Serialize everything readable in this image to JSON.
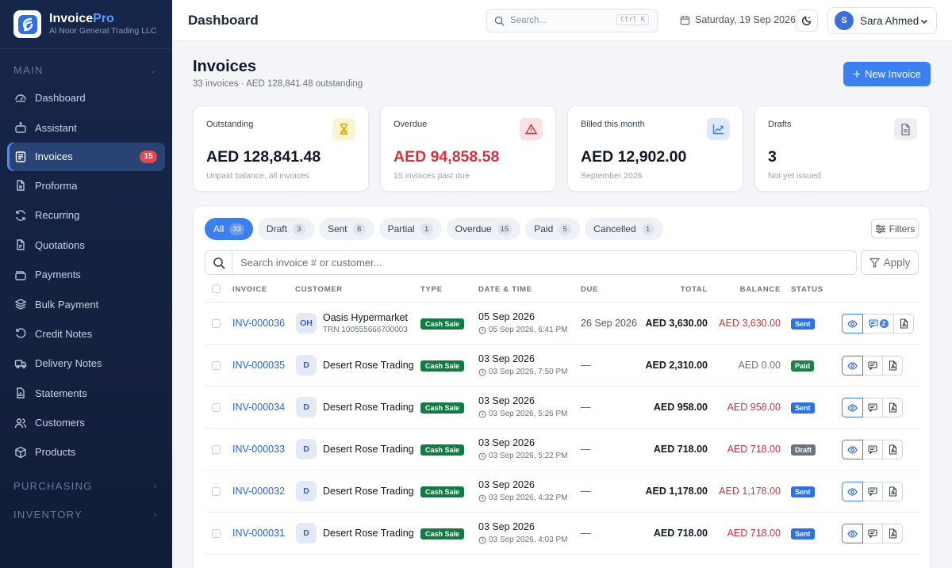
{
  "brand": {
    "name_main": "Invoice",
    "name_accent": "Pro",
    "company": "Al Noor General Trading LLC"
  },
  "sidebar": {
    "section_main": "MAIN",
    "items": [
      {
        "label": "Dashboard",
        "icon": "dashboard-icon"
      },
      {
        "label": "Assistant",
        "icon": "robot-icon"
      },
      {
        "label": "Invoices",
        "icon": "invoice-icon",
        "badge": "15",
        "active": true
      },
      {
        "label": "Proforma",
        "icon": "document-icon"
      },
      {
        "label": "Recurring",
        "icon": "refresh-icon"
      },
      {
        "label": "Quotations",
        "icon": "quote-document-icon"
      },
      {
        "label": "Payments",
        "icon": "wallet-icon"
      },
      {
        "label": "Bulk Payment",
        "icon": "layers-icon"
      },
      {
        "label": "Credit Notes",
        "icon": "undo-icon"
      },
      {
        "label": "Delivery Notes",
        "icon": "truck-icon"
      },
      {
        "label": "Statements",
        "icon": "statement-icon"
      },
      {
        "label": "Customers",
        "icon": "users-icon"
      },
      {
        "label": "Products",
        "icon": "box-icon"
      }
    ],
    "section_purchasing": "PURCHASING",
    "section_inventory": "INVENTORY"
  },
  "topbar": {
    "title": "Dashboard",
    "search_placeholder": "Search...",
    "search_shortcut": "Ctrl K",
    "date": "Saturday, 19 Sep 2026",
    "user_initial": "S",
    "user_name": "Sara Ahmed"
  },
  "page": {
    "title": "Invoices",
    "subtitle": "33 invoices · AED 128,841.48 outstanding",
    "new_button": "New Invoice"
  },
  "cards": [
    {
      "label": "Outstanding",
      "value": "AED 128,841.48",
      "sub": "Unpaid balance, all invoices",
      "icon": "hourglass-icon",
      "color": "#f5b400"
    },
    {
      "label": "Overdue",
      "value": "AED 94,858.58",
      "sub": "15 invoices past due",
      "icon": "warning-icon",
      "color": "#d1343f"
    },
    {
      "label": "Billed this month",
      "value": "AED 12,902.00",
      "sub": "September 2026",
      "icon": "trend-up-icon",
      "color": "#3b7ff0"
    },
    {
      "label": "Drafts",
      "value": "3",
      "sub": "Not yet issued",
      "icon": "draft-document-icon",
      "color": "#6b7280"
    }
  ],
  "tabs": [
    {
      "label": "All",
      "count": "33",
      "active": true
    },
    {
      "label": "Draft",
      "count": "3"
    },
    {
      "label": "Sent",
      "count": "8"
    },
    {
      "label": "Partial",
      "count": "1"
    },
    {
      "label": "Overdue",
      "count": "15"
    },
    {
      "label": "Paid",
      "count": "5"
    },
    {
      "label": "Cancelled",
      "count": "1"
    }
  ],
  "toolbar": {
    "filters": "Filters",
    "search_placeholder": "Search invoice # or customer...",
    "apply": "Apply"
  },
  "table": {
    "headers": {
      "invoice": "INVOICE",
      "customer": "CUSTOMER",
      "type": "TYPE",
      "datetime": "DATE & TIME",
      "due": "DUE",
      "total": "TOTAL",
      "balance": "BALANCE",
      "status": "STATUS"
    },
    "rows": [
      {
        "invoice": "INV-000036",
        "initials": "OH",
        "customer": "Oasis Hypermarket",
        "trn": "TRN 100555666700003",
        "type": "Cash Sale",
        "date": "05 Sep 2026",
        "time": "05 Sep 2026, 6:41 PM",
        "due": "26 Sep 2026",
        "total": "AED 3,630.00",
        "balance": "AED 3,630.00",
        "status": "Sent",
        "comments": "2"
      },
      {
        "invoice": "INV-000035",
        "initials": "D",
        "customer": "Desert Rose Trading",
        "trn": "",
        "type": "Cash Sale",
        "date": "03 Sep 2026",
        "time": "03 Sep 2026, 7:50 PM",
        "due": "—",
        "total": "AED 2,310.00",
        "balance": "AED 0.00",
        "status": "Paid",
        "comments": ""
      },
      {
        "invoice": "INV-000034",
        "initials": "D",
        "customer": "Desert Rose Trading",
        "trn": "",
        "type": "Cash Sale",
        "date": "03 Sep 2026",
        "time": "03 Sep 2026, 5:26 PM",
        "due": "—",
        "total": "AED 958.00",
        "balance": "AED 958.00",
        "status": "Sent",
        "comments": ""
      },
      {
        "invoice": "INV-000033",
        "initials": "D",
        "customer": "Desert Rose Trading",
        "trn": "",
        "type": "Cash Sale",
        "date": "03 Sep 2026",
        "time": "03 Sep 2026, 5:22 PM",
        "due": "—",
        "total": "AED 718.00",
        "balance": "AED 718.00",
        "status": "Draft",
        "comments": ""
      },
      {
        "invoice": "INV-000032",
        "initials": "D",
        "customer": "Desert Rose Trading",
        "trn": "",
        "type": "Cash Sale",
        "date": "03 Sep 2026",
        "time": "03 Sep 2026, 4:32 PM",
        "due": "—",
        "total": "AED 1,178.00",
        "balance": "AED 1,178.00",
        "status": "Sent",
        "comments": ""
      },
      {
        "invoice": "INV-000031",
        "initials": "D",
        "customer": "Desert Rose Trading",
        "trn": "",
        "type": "Cash Sale",
        "date": "03 Sep 2026",
        "time": "03 Sep 2026, 4:03 PM",
        "due": "—",
        "total": "AED 718.00",
        "balance": "AED 718.00",
        "status": "Sent",
        "comments": ""
      }
    ]
  }
}
